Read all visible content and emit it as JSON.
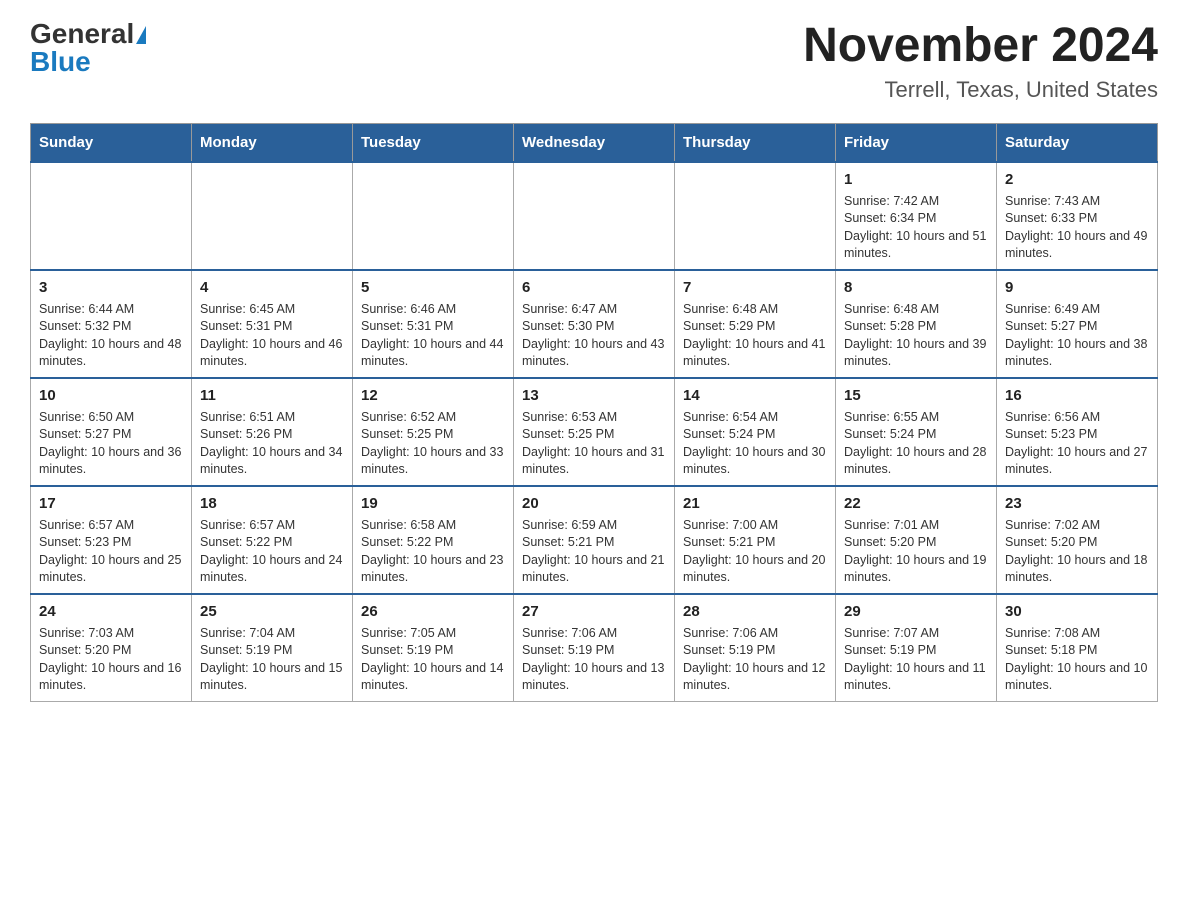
{
  "header": {
    "logo_general": "General",
    "logo_blue": "Blue",
    "title": "November 2024",
    "subtitle": "Terrell, Texas, United States"
  },
  "calendar": {
    "days_of_week": [
      "Sunday",
      "Monday",
      "Tuesday",
      "Wednesday",
      "Thursday",
      "Friday",
      "Saturday"
    ],
    "weeks": [
      [
        {
          "day": "",
          "info": ""
        },
        {
          "day": "",
          "info": ""
        },
        {
          "day": "",
          "info": ""
        },
        {
          "day": "",
          "info": ""
        },
        {
          "day": "",
          "info": ""
        },
        {
          "day": "1",
          "info": "Sunrise: 7:42 AM\nSunset: 6:34 PM\nDaylight: 10 hours and 51 minutes."
        },
        {
          "day": "2",
          "info": "Sunrise: 7:43 AM\nSunset: 6:33 PM\nDaylight: 10 hours and 49 minutes."
        }
      ],
      [
        {
          "day": "3",
          "info": "Sunrise: 6:44 AM\nSunset: 5:32 PM\nDaylight: 10 hours and 48 minutes."
        },
        {
          "day": "4",
          "info": "Sunrise: 6:45 AM\nSunset: 5:31 PM\nDaylight: 10 hours and 46 minutes."
        },
        {
          "day": "5",
          "info": "Sunrise: 6:46 AM\nSunset: 5:31 PM\nDaylight: 10 hours and 44 minutes."
        },
        {
          "day": "6",
          "info": "Sunrise: 6:47 AM\nSunset: 5:30 PM\nDaylight: 10 hours and 43 minutes."
        },
        {
          "day": "7",
          "info": "Sunrise: 6:48 AM\nSunset: 5:29 PM\nDaylight: 10 hours and 41 minutes."
        },
        {
          "day": "8",
          "info": "Sunrise: 6:48 AM\nSunset: 5:28 PM\nDaylight: 10 hours and 39 minutes."
        },
        {
          "day": "9",
          "info": "Sunrise: 6:49 AM\nSunset: 5:27 PM\nDaylight: 10 hours and 38 minutes."
        }
      ],
      [
        {
          "day": "10",
          "info": "Sunrise: 6:50 AM\nSunset: 5:27 PM\nDaylight: 10 hours and 36 minutes."
        },
        {
          "day": "11",
          "info": "Sunrise: 6:51 AM\nSunset: 5:26 PM\nDaylight: 10 hours and 34 minutes."
        },
        {
          "day": "12",
          "info": "Sunrise: 6:52 AM\nSunset: 5:25 PM\nDaylight: 10 hours and 33 minutes."
        },
        {
          "day": "13",
          "info": "Sunrise: 6:53 AM\nSunset: 5:25 PM\nDaylight: 10 hours and 31 minutes."
        },
        {
          "day": "14",
          "info": "Sunrise: 6:54 AM\nSunset: 5:24 PM\nDaylight: 10 hours and 30 minutes."
        },
        {
          "day": "15",
          "info": "Sunrise: 6:55 AM\nSunset: 5:24 PM\nDaylight: 10 hours and 28 minutes."
        },
        {
          "day": "16",
          "info": "Sunrise: 6:56 AM\nSunset: 5:23 PM\nDaylight: 10 hours and 27 minutes."
        }
      ],
      [
        {
          "day": "17",
          "info": "Sunrise: 6:57 AM\nSunset: 5:23 PM\nDaylight: 10 hours and 25 minutes."
        },
        {
          "day": "18",
          "info": "Sunrise: 6:57 AM\nSunset: 5:22 PM\nDaylight: 10 hours and 24 minutes."
        },
        {
          "day": "19",
          "info": "Sunrise: 6:58 AM\nSunset: 5:22 PM\nDaylight: 10 hours and 23 minutes."
        },
        {
          "day": "20",
          "info": "Sunrise: 6:59 AM\nSunset: 5:21 PM\nDaylight: 10 hours and 21 minutes."
        },
        {
          "day": "21",
          "info": "Sunrise: 7:00 AM\nSunset: 5:21 PM\nDaylight: 10 hours and 20 minutes."
        },
        {
          "day": "22",
          "info": "Sunrise: 7:01 AM\nSunset: 5:20 PM\nDaylight: 10 hours and 19 minutes."
        },
        {
          "day": "23",
          "info": "Sunrise: 7:02 AM\nSunset: 5:20 PM\nDaylight: 10 hours and 18 minutes."
        }
      ],
      [
        {
          "day": "24",
          "info": "Sunrise: 7:03 AM\nSunset: 5:20 PM\nDaylight: 10 hours and 16 minutes."
        },
        {
          "day": "25",
          "info": "Sunrise: 7:04 AM\nSunset: 5:19 PM\nDaylight: 10 hours and 15 minutes."
        },
        {
          "day": "26",
          "info": "Sunrise: 7:05 AM\nSunset: 5:19 PM\nDaylight: 10 hours and 14 minutes."
        },
        {
          "day": "27",
          "info": "Sunrise: 7:06 AM\nSunset: 5:19 PM\nDaylight: 10 hours and 13 minutes."
        },
        {
          "day": "28",
          "info": "Sunrise: 7:06 AM\nSunset: 5:19 PM\nDaylight: 10 hours and 12 minutes."
        },
        {
          "day": "29",
          "info": "Sunrise: 7:07 AM\nSunset: 5:19 PM\nDaylight: 10 hours and 11 minutes."
        },
        {
          "day": "30",
          "info": "Sunrise: 7:08 AM\nSunset: 5:18 PM\nDaylight: 10 hours and 10 minutes."
        }
      ]
    ]
  }
}
